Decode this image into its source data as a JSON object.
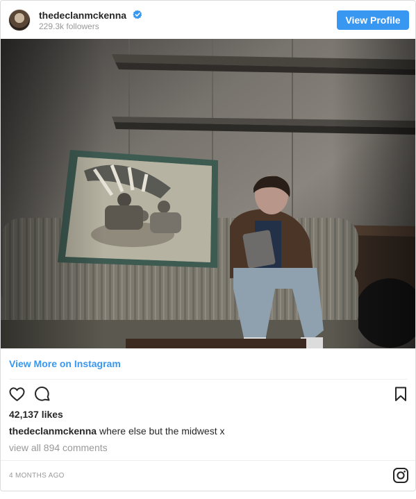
{
  "header": {
    "username": "thedeclanmckenna",
    "followers": "229.3k followers",
    "view_profile": "View Profile",
    "verified_icon": "verified-badge-icon",
    "accent": "#3897f0"
  },
  "post": {
    "view_more": "View More on Instagram",
    "likes": "42,137 likes",
    "caption_user": "thedeclanmckenna",
    "caption_text": "where else but the midwest x",
    "comments": "view all 894 comments",
    "time": "4 MONTHS AGO"
  },
  "icons": {
    "like": "heart-icon",
    "comment": "comment-icon",
    "save": "bookmark-icon",
    "brand": "instagram-icon"
  }
}
